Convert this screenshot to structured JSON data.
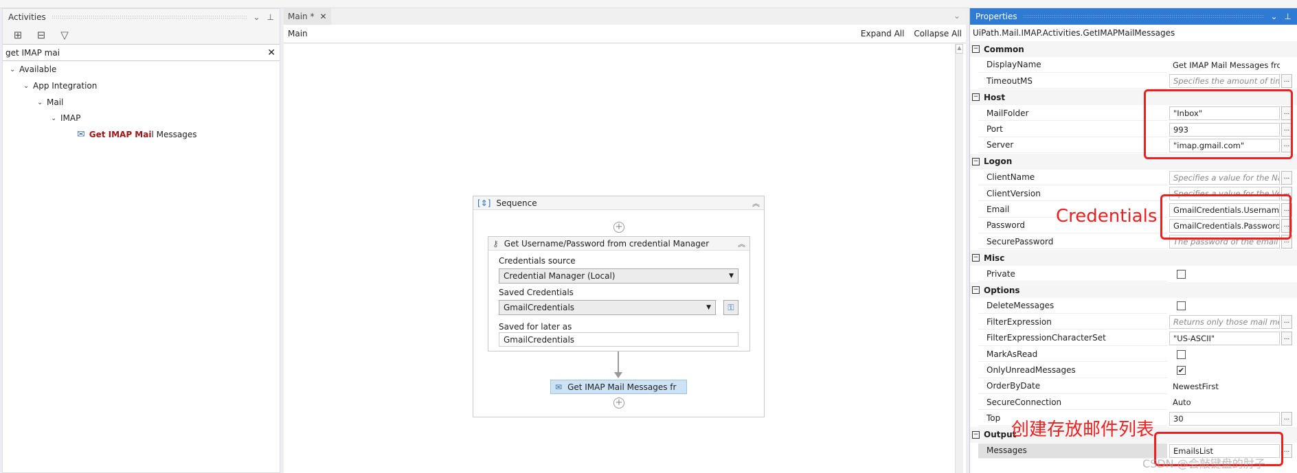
{
  "activities": {
    "title": "Activities",
    "search_value": "get IMAP mai",
    "tree": [
      {
        "label": "Available",
        "level": 0
      },
      {
        "label": "App Integration",
        "level": 1
      },
      {
        "label": "Mail",
        "level": 2
      },
      {
        "label": "IMAP",
        "level": 3
      }
    ],
    "result": {
      "match": "Get IMAP Mai",
      "rest": "l Messages"
    }
  },
  "center": {
    "tab": "Main *",
    "breadcrumb": "Main",
    "expand_all": "Expand All",
    "collapse_all": "Collapse All",
    "sequence": {
      "title": "Sequence",
      "cred_activity": {
        "title": "Get Username/Password from credential Manager",
        "source_label": "Credentials source",
        "source_value": "Credential Manager (Local)",
        "saved_label": "Saved Credentials",
        "saved_value": "GmailCredentials",
        "later_label": "Saved for later as",
        "later_value": "GmailCredentials"
      },
      "imap_activity": "Get IMAP Mail Messages fr"
    }
  },
  "properties": {
    "title": "Properties",
    "type_name": "UiPath.Mail.IMAP.Activities.GetIMAPMailMessages",
    "categories": {
      "common": "Common",
      "host": "Host",
      "logon": "Logon",
      "misc": "Misc",
      "options": "Options",
      "output": "Output"
    },
    "rows": {
      "DisplayName": {
        "name": "DisplayName",
        "value": "Get IMAP Mail Messages from GMail"
      },
      "TimeoutMS": {
        "name": "TimeoutMS",
        "placeholder": "Specifies the amount of time"
      },
      "MailFolder": {
        "name": "MailFolder",
        "value": "\"Inbox\""
      },
      "Port": {
        "name": "Port",
        "value": "993"
      },
      "Server": {
        "name": "Server",
        "value": "\"imap.gmail.com\""
      },
      "ClientName": {
        "name": "ClientName",
        "placeholder": "Specifies a value for the Name"
      },
      "ClientVersion": {
        "name": "ClientVersion",
        "placeholder": "Specifies a value for the Version"
      },
      "Email": {
        "name": "Email",
        "value": "GmailCredentials.Username"
      },
      "Password": {
        "name": "Password",
        "value": "GmailCredentials.Password"
      },
      "SecurePassword": {
        "name": "SecurePassword",
        "placeholder": "The password of the email account"
      },
      "Private": {
        "name": "Private",
        "checked": false
      },
      "DeleteMessages": {
        "name": "DeleteMessages",
        "checked": false
      },
      "FilterExpression": {
        "name": "FilterExpression",
        "placeholder": "Returns only those mail messages"
      },
      "FilterExpressionCharacterSet": {
        "name": "FilterExpressionCharacterSet",
        "value": "\"US-ASCII\""
      },
      "MarkAsRead": {
        "name": "MarkAsRead",
        "checked": false
      },
      "OnlyUnreadMessages": {
        "name": "OnlyUnreadMessages",
        "checked": true
      },
      "OrderByDate": {
        "name": "OrderByDate",
        "value": "NewestFirst"
      },
      "SecureConnection": {
        "name": "SecureConnection",
        "value": "Auto"
      },
      "Top": {
        "name": "Top",
        "value": "30"
      },
      "Messages": {
        "name": "Messages",
        "value": "EmailsList"
      }
    },
    "ellipsis": "..."
  },
  "annotations": {
    "credentials": "Credentials",
    "create_list": "创建存放邮件列表",
    "color": "#f01e1e"
  },
  "watermark": "CSDN @会敲键盘的肘子",
  "colors": {
    "accent": "#2f7bd4",
    "match": "#a31515",
    "selected_activity": "#cde3f5"
  }
}
